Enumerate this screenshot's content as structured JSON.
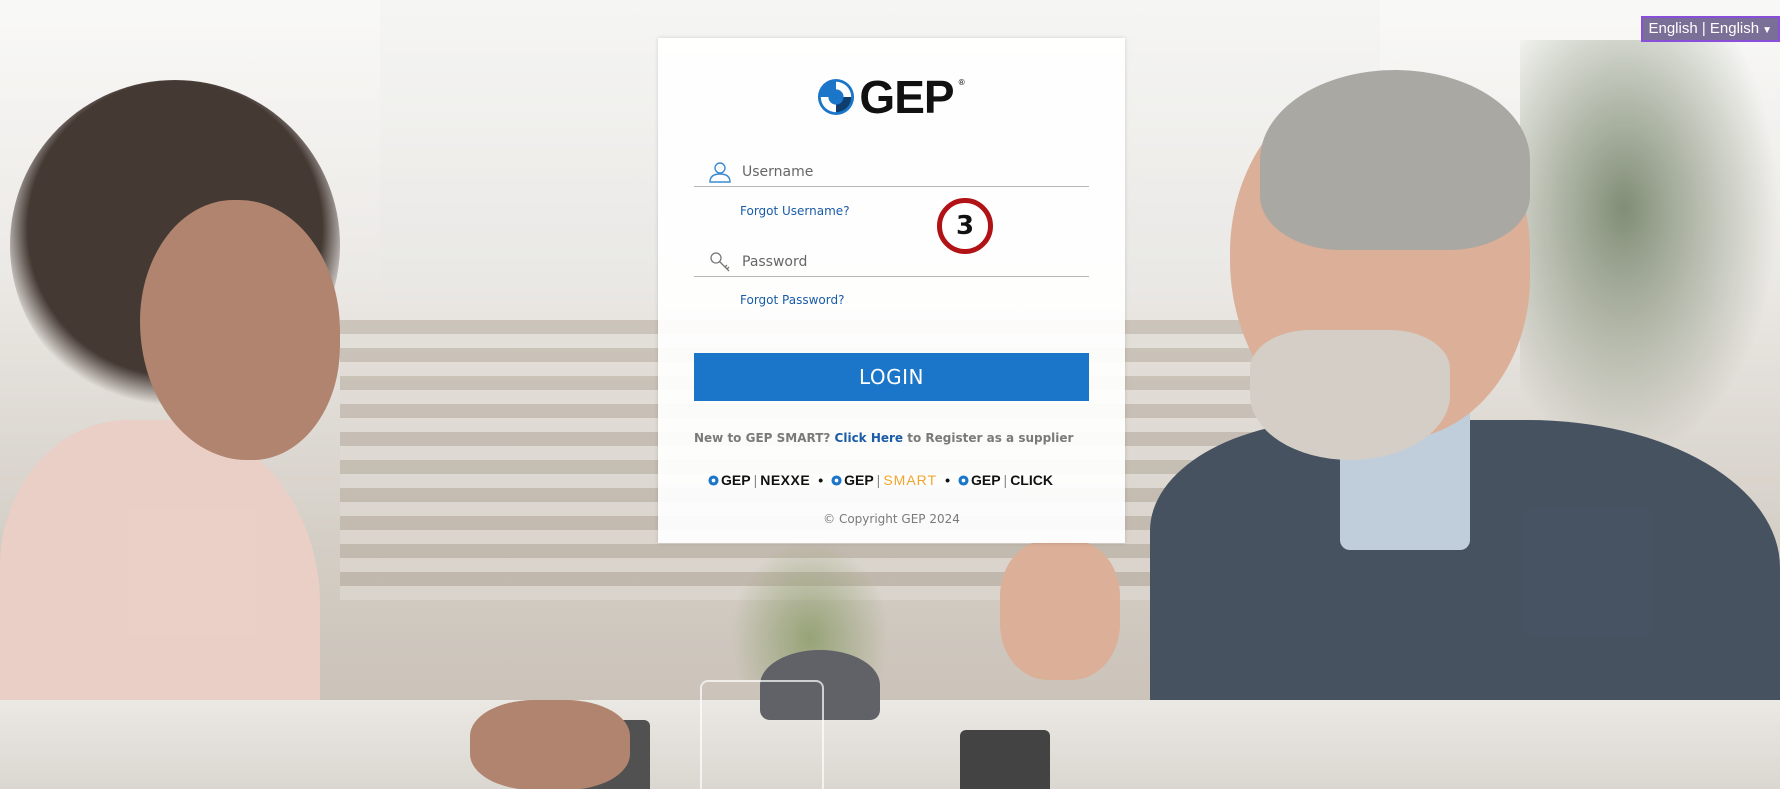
{
  "language_selector": {
    "label": "English | English",
    "caret_icon": "chevron-down-icon"
  },
  "logo": {
    "text": "GEP",
    "registered": "®",
    "icon": "gep-swirl-logo-icon"
  },
  "login_form": {
    "username_placeholder": "Username",
    "username_value": "",
    "username_icon": "user-icon",
    "forgot_username": "Forgot Username?",
    "password_placeholder": "Password",
    "password_value": "",
    "password_icon": "key-icon",
    "forgot_password": "Forgot Password?",
    "login_button": "LOGIN"
  },
  "register": {
    "prefix": "New to GEP SMART?",
    "link": "Click Here",
    "suffix": "to Register as a supplier"
  },
  "products": [
    {
      "brand": "GEP",
      "name": "NEXXE"
    },
    {
      "brand": "GEP",
      "name": "SMART"
    },
    {
      "brand": "GEP",
      "name": "CLICK"
    }
  ],
  "product_separator": "•",
  "copyright": "© Copyright GEP 2024",
  "step_marker": "3",
  "colors": {
    "primary_blue": "#1b76c9",
    "link_blue": "#1a5ca8",
    "smart_orange": "#f0a531",
    "marker_red": "#b01215",
    "language_border": "#8a4fd8"
  }
}
